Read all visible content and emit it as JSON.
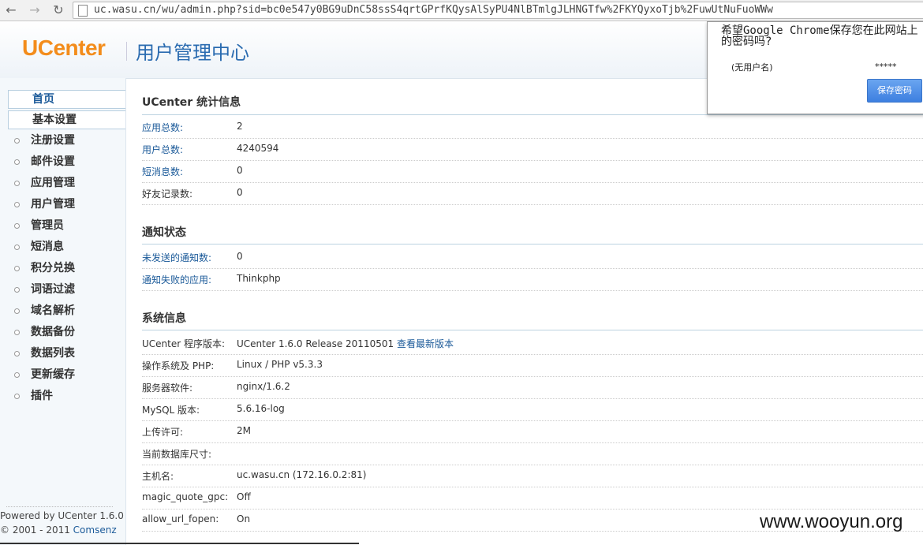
{
  "browser": {
    "url": "uc.wasu.cn/wu/admin.php?sid=bc0e547y0BG9uDnC58ssS4qrtGPrfKQysAlSyPU4NlBTmlgJLHNGTfw%2FKYQyxoTjb%2FuwUtNuFuoWWw"
  },
  "header": {
    "logo": "UCenter",
    "title": "用户管理中心"
  },
  "sidebar": {
    "tabs": [
      "首页",
      "基本设置"
    ],
    "items": [
      "注册设置",
      "邮件设置",
      "应用管理",
      "用户管理",
      "管理员",
      "短消息",
      "积分兑换",
      "词语过滤",
      "域名解析",
      "数据备份",
      "数据列表",
      "更新缓存",
      "插件"
    ],
    "powered": "Powered by UCenter 1.6.0",
    "copyright": "© 2001 - 2011 ",
    "copyright_link": "Comsenz"
  },
  "sections": {
    "stats": {
      "title": "UCenter 统计信息",
      "rows": [
        {
          "label": "应用总数:",
          "value": "2"
        },
        {
          "label": "用户总数:",
          "value": "4240594"
        },
        {
          "label": "短消息数:",
          "value": "0"
        },
        {
          "label": "好友记录数:",
          "value": "0"
        }
      ]
    },
    "notify": {
      "title": "通知状态",
      "rows": [
        {
          "label": "未发送的通知数:",
          "value": "0"
        },
        {
          "label": "通知失败的应用:",
          "value": "Thinkphp"
        }
      ]
    },
    "system": {
      "title": "系统信息",
      "rows": [
        {
          "label": "UCenter 程序版本:",
          "value": "UCenter 1.6.0 Release 20110501 ",
          "link": "查看最新版本"
        },
        {
          "label": "操作系统及 PHP:",
          "value": "Linux / PHP v5.3.3"
        },
        {
          "label": "服务器软件:",
          "value": "nginx/1.6.2"
        },
        {
          "label": "MySQL 版本:",
          "value": "5.6.16-log"
        },
        {
          "label": "上传许可:",
          "value": "2M"
        },
        {
          "label": "当前数据库尺寸:",
          "value": ""
        },
        {
          "label": "主机名:",
          "value": "uc.wasu.cn (172.16.0.2:81)"
        },
        {
          "label": "magic_quote_gpc:",
          "value": "Off"
        },
        {
          "label": "allow_url_fopen:",
          "value": "On"
        }
      ]
    }
  },
  "popup": {
    "message": "希望Google Chrome保存您在此网站上的密码吗?",
    "user": "(无用户名)",
    "password": "*****",
    "save_button": "保存密码"
  },
  "watermark": "www.wooyun.org",
  "colors": {
    "accent": "#1b5a99",
    "logo": "#f38c1b"
  }
}
